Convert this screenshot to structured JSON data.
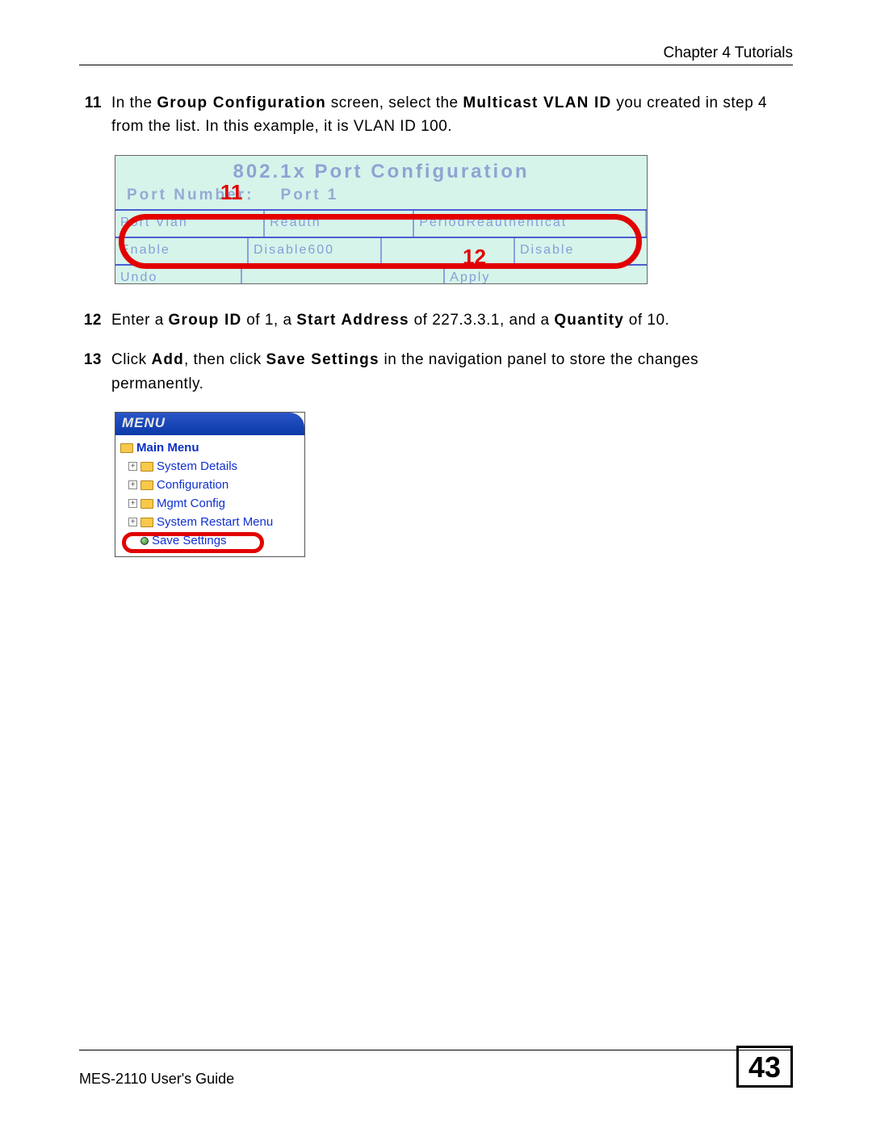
{
  "header": {
    "chapter": "Chapter 4 Tutorials"
  },
  "steps": {
    "s11": {
      "num": "11",
      "pre": "In the ",
      "b1": "Group Configuration",
      "mid": " screen, select the ",
      "b2": "Multicast VLAN ID",
      "post": " you created in step 4 from the list. In this example, it is VLAN ID 100."
    },
    "s12": {
      "num": "12",
      "pre": "Enter a ",
      "b1": "Group ID",
      "m1": " of 1, a ",
      "b2": "Start Address",
      "m2": " of 227.3.3.1, and a ",
      "b3": "Quantity",
      "post": " of 10."
    },
    "s13": {
      "num": "13",
      "pre": "Click ",
      "b1": "Add",
      "m1": ", then click ",
      "b2": "Save Settings",
      "post": " in the navigation panel to store the changes permanently."
    }
  },
  "fig1": {
    "title": "802.1x Port Configuration",
    "sub_label": "Port Number:",
    "sub_value": "Port 1",
    "row1": {
      "c1": "Port Vlan",
      "c2": "Reauth",
      "c3": "PeriodReauthenticat"
    },
    "row2": {
      "c1": "Enable",
      "c2": "Disable600",
      "c3": "",
      "c4": "Disable"
    },
    "row3": {
      "c1": "Undo",
      "c2": "",
      "c3": "Apply"
    },
    "callout11": "11",
    "callout12": "12"
  },
  "fig2": {
    "header": "MENU",
    "main": "Main Menu",
    "items": [
      "System Details",
      "Configuration",
      "Mgmt Config",
      "System Restart Menu"
    ],
    "save": "Save Settings"
  },
  "footer": {
    "guide": "MES-2110 User's Guide",
    "page": "43"
  }
}
